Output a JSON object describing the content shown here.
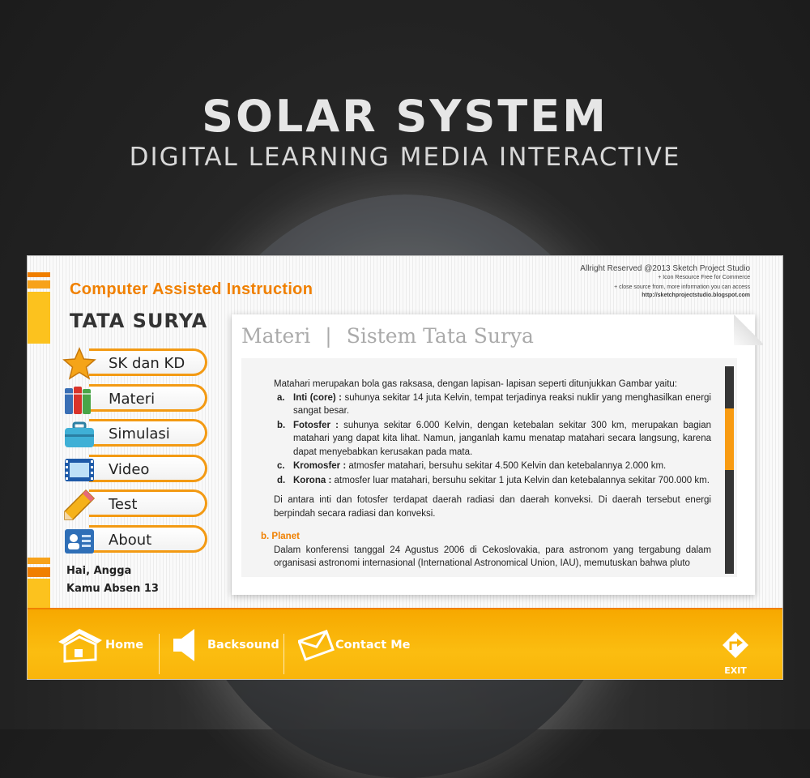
{
  "hero": {
    "title": "SOLAR SYSTEM",
    "subtitle": "DIGITAL LEARNING MEDIA INTERACTIVE"
  },
  "app": {
    "heading": "Computer Assisted Instruction",
    "subheading": "TATA SURYA",
    "copyright": {
      "line1": "Allright Reserved @2013 Sketch Project Studio",
      "line2": "+ Icon Resource Free for Commerce",
      "line3": "+ close source from, more information you can access",
      "url": "http://sketchprojectstudio.blogspot.com"
    }
  },
  "menu": {
    "items": [
      {
        "label": "SK dan KD",
        "icon": "star-icon"
      },
      {
        "label": "Materi",
        "icon": "books-icon"
      },
      {
        "label": "Simulasi",
        "icon": "toolbox-icon"
      },
      {
        "label": "Video",
        "icon": "film-icon"
      },
      {
        "label": "Test",
        "icon": "pencil-icon"
      },
      {
        "label": "About",
        "icon": "id-card-icon"
      }
    ]
  },
  "user": {
    "greeting": "Hai, Angga",
    "absen": "Kamu Absen 13"
  },
  "panel": {
    "section": "Materi",
    "separator": "|",
    "topic": "Sistem Tata Surya",
    "intro": "Matahari merupakan bola gas raksasa, dengan lapisan- lapisan seperti ditunjukkan Gambar yaitu:",
    "list": [
      {
        "letter": "a.",
        "term": "Inti (core) :",
        "text": " suhunya sekitar 14 juta Kelvin, tempat terjadinya reaksi nuklir yang menghasilkan energi sangat besar."
      },
      {
        "letter": "b.",
        "term": "Fotosfer :",
        "text": " suhunya sekitar 6.000 Kelvin, dengan ketebalan sekitar 300 km, merupakan bagian matahari yang dapat kita lihat. Namun, janganlah kamu menatap matahari secara langsung, karena dapat menyebabkan kerusakan pada mata."
      },
      {
        "letter": "c.",
        "term": "Kromosfer :",
        "text": " atmosfer matahari, bersuhu sekitar 4.500 Kelvin dan ketebalannya 2.000 km."
      },
      {
        "letter": "d.",
        "term": "Korona :",
        "text": " atmosfer luar matahari, bersuhu sekitar 1 juta Kelvin dan ketebalannya sekitar 700.000 km."
      }
    ],
    "para2": "Di antara inti dan fotosfer terdapat daerah radiasi dan daerah konveksi. Di daerah tersebut energi berpindah secara radiasi dan konveksi.",
    "planet_heading": "b. Planet",
    "para3": "Dalam konferensi tanggal 24 Agustus 2006 di Cekoslovakia, para astronom yang tergabung dalam organisasi astronomi internasional (International Astronomical Union, IAU), memutuskan bahwa pluto"
  },
  "bottom": {
    "home": "Home",
    "backsound": "Backsound",
    "contact": "Contact Me",
    "exit": "EXIT"
  },
  "colors": {
    "accent": "#f08000",
    "accent_light": "#fcc21e",
    "scroll_thumb": "#f89b12"
  }
}
